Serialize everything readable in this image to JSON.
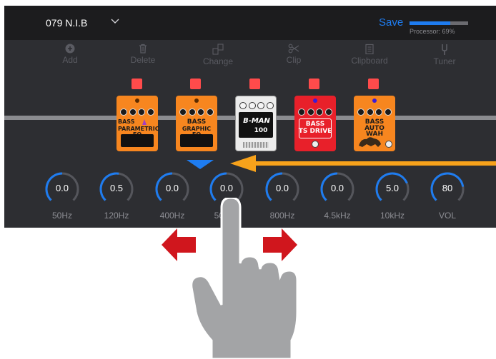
{
  "header": {
    "preset_name": "079 N.I.B",
    "save_label": "Save",
    "processor_label": "Processor: 69%",
    "processor_percent": 69,
    "accent_color": "#1e7cf0"
  },
  "toolbar": [
    {
      "label": "Add",
      "icon": "plus-circle-icon"
    },
    {
      "label": "Delete",
      "icon": "trash-icon"
    },
    {
      "label": "Change",
      "icon": "swap-icon"
    },
    {
      "label": "Clip",
      "icon": "scissors-icon"
    },
    {
      "label": "Clipboard",
      "icon": "clipboard-icon"
    },
    {
      "label": "Tuner",
      "icon": "tuning-fork-icon"
    }
  ],
  "pedals": [
    {
      "line1": "BASS",
      "line2": "PARAMETRIC EQ",
      "color": "#f7861f",
      "selected": false
    },
    {
      "line1": "BASS",
      "line2": "GRAPHIC EQ",
      "color": "#f7861f",
      "selected": true
    },
    {
      "line1": "B-MAN",
      "line2": "100",
      "color": "#ececec",
      "selected": false
    },
    {
      "line1": "BASS",
      "line2": "TS DRIVE",
      "color": "#e8202a",
      "selected": false
    },
    {
      "line1": "BASS",
      "line2": "AUTO WAH",
      "color": "#f7861f",
      "selected": false
    }
  ],
  "knobs": [
    {
      "value": "0.0",
      "label": "50Hz",
      "fraction": 0.5
    },
    {
      "value": "0.5",
      "label": "120Hz",
      "fraction": 0.53
    },
    {
      "value": "0.0",
      "label": "400Hz",
      "fraction": 0.5
    },
    {
      "value": "0.0",
      "label": "500Hz",
      "fraction": 0.5
    },
    {
      "value": "0.0",
      "label": "800Hz",
      "fraction": 0.5
    },
    {
      "value": "0.0",
      "label": "4.5kHz",
      "fraction": 0.5
    },
    {
      "value": "5.0",
      "label": "10kHz",
      "fraction": 0.75
    },
    {
      "value": "80",
      "label": "VOL",
      "fraction": 0.8
    }
  ],
  "colors": {
    "toggle_on": "#ff4b4b",
    "flow_arrow": "#f7a21b",
    "swipe_arrow": "#d0161d",
    "hand": "#a3a4a6"
  }
}
